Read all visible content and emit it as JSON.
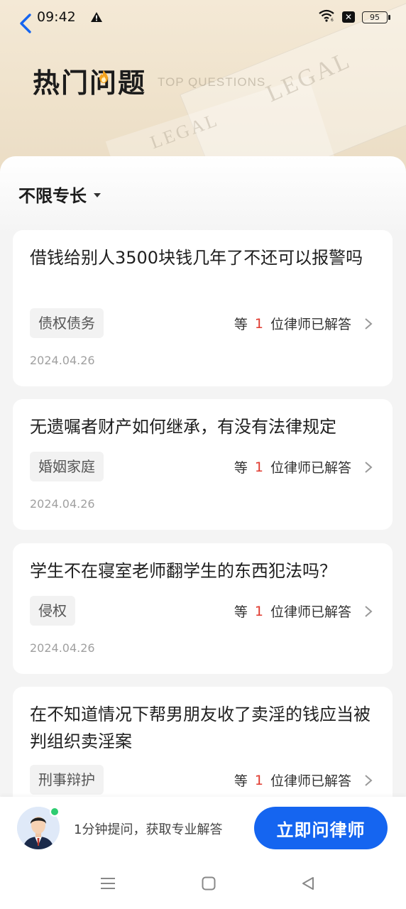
{
  "status_bar": {
    "time": "09:42",
    "battery": "95",
    "icons": [
      "back-arrow-icon",
      "warning-icon",
      "wifi-icon",
      "x-icon",
      "battery-icon"
    ]
  },
  "header": {
    "title": "热门问题",
    "title_en": "TOP QUESTIONS",
    "bg_words": [
      "LEGAL",
      "LEGAL"
    ]
  },
  "filter": {
    "label": "不限专长"
  },
  "questions": [
    {
      "question": "借钱给别人3500块钱几年了不还可以报警吗",
      "tag": "债权债务",
      "answer_prefix": "等",
      "answer_count": "1",
      "answer_suffix": "位律师已解答",
      "date": "2024.04.26"
    },
    {
      "question": "无遗嘱者财产如何继承，有没有法律规定",
      "tag": "婚姻家庭",
      "answer_prefix": "等",
      "answer_count": "1",
      "answer_suffix": "位律师已解答",
      "date": "2024.04.26"
    },
    {
      "question": "学生不在寝室老师翻学生的东西犯法吗？",
      "tag": "侵权",
      "answer_prefix": "等",
      "answer_count": "1",
      "answer_suffix": "位律师已解答",
      "date": "2024.04.26"
    },
    {
      "question": "在不知道情况下帮男朋友收了卖淫的钱应当被判组织卖淫案",
      "tag": "刑事辩护",
      "answer_prefix": "等",
      "answer_count": "1",
      "answer_suffix": "位律师已解答",
      "date": ""
    }
  ],
  "bottom_bar": {
    "prompt": "1分钟提问，获取专业解答",
    "button_label": "立即问律师",
    "accent": "#1565f0",
    "online_color": "#2ecc71"
  },
  "nav_bar": {
    "icons": [
      "menu-icon",
      "home-icon",
      "back-icon"
    ]
  },
  "colors": {
    "answer_count": "#e0392e",
    "header_bg": "#efe2cb"
  }
}
